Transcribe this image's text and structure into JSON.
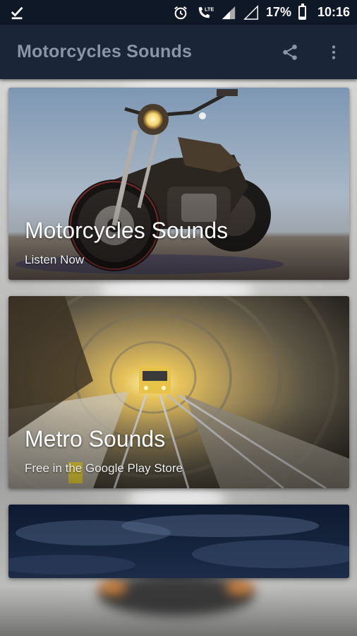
{
  "status_bar": {
    "battery": "17%",
    "time": "10:16",
    "network": "LTE",
    "icons": [
      "download-done-icon",
      "alarm-icon",
      "volte-call-icon",
      "signal-icon",
      "no-signal-icon",
      "battery-icon"
    ]
  },
  "app_bar": {
    "title": "Motorcycles Sounds",
    "icons": [
      "share-icon",
      "more-vert-icon"
    ]
  },
  "cards": [
    {
      "title": "Motorcycles Sounds",
      "subtitle": "Listen Now",
      "image": "motorcycle-photo"
    },
    {
      "title": "Metro Sounds",
      "subtitle": "Free in the Google Play Store",
      "image": "metro-tunnel-photo"
    },
    {
      "title": "",
      "subtitle": "",
      "image": "night-sky-photo"
    }
  ],
  "colors": {
    "status_bar": "#0f1826",
    "app_bar": "#1a2638",
    "app_title": "#8b95a6"
  }
}
